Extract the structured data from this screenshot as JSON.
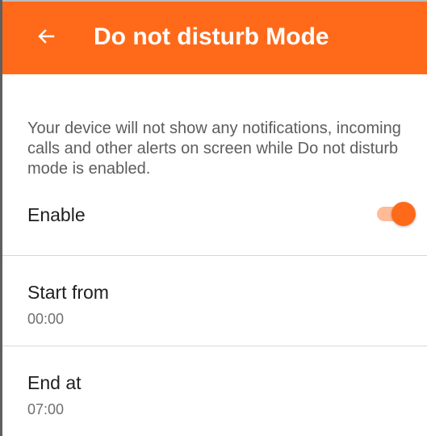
{
  "colors": {
    "accent": "#ff6a1a",
    "accent_light": "#ffbb98",
    "description_text": "#5d5d5d",
    "secondary_text": "#6f6f6f",
    "divider": "#d8d8d8"
  },
  "header": {
    "back_icon": "arrow-left-icon",
    "title": "Do not disturb Mode"
  },
  "description": "Your device will not show any notifications, incoming calls and other alerts on screen while Do not disturb mode is enabled.",
  "settings": {
    "enable": {
      "label": "Enable",
      "checked": true
    },
    "start": {
      "label": "Start from",
      "value": "00:00"
    },
    "end": {
      "label": "End at",
      "value": "07:00"
    }
  }
}
